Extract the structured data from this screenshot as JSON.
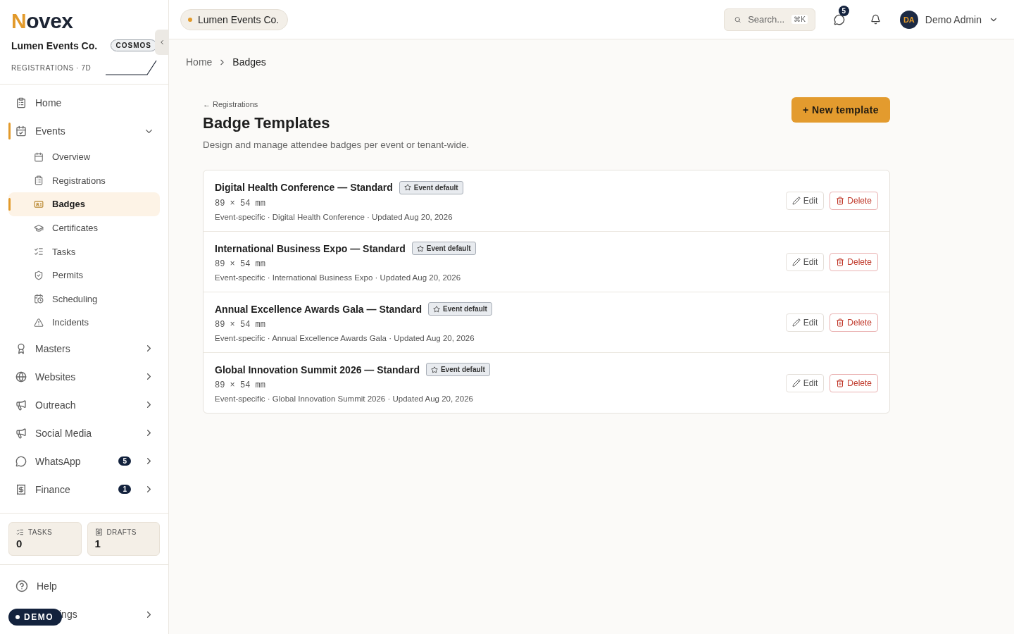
{
  "brand": {
    "logo_initial": "N",
    "logo_rest": "ovex",
    "org": "Lumen Events Co.",
    "plan": "COSMOS",
    "metric_label": "REGISTRATIONS · 7D"
  },
  "nav": [
    {
      "label": "Home",
      "selected": false
    },
    {
      "label": "Events",
      "selected": false,
      "expanded": true,
      "children": [
        {
          "label": "Overview",
          "selected": false
        },
        {
          "label": "Registrations",
          "selected": false
        },
        {
          "label": "Badges",
          "selected": true
        },
        {
          "label": "Certificates",
          "selected": false
        },
        {
          "label": "Tasks",
          "selected": false
        },
        {
          "label": "Permits",
          "selected": false
        },
        {
          "label": "Scheduling",
          "selected": false
        },
        {
          "label": "Incidents",
          "selected": false
        }
      ]
    },
    {
      "label": "Masters",
      "selected": false,
      "expanded": false
    },
    {
      "label": "Websites",
      "selected": false,
      "expanded": false
    },
    {
      "label": "Outreach",
      "selected": false,
      "expanded": false
    },
    {
      "label": "Social Media",
      "selected": false,
      "expanded": false
    },
    {
      "label": "WhatsApp",
      "selected": false,
      "expanded": false,
      "count": "5"
    },
    {
      "label": "Finance",
      "selected": false,
      "expanded": false,
      "count": "1"
    }
  ],
  "stats": [
    {
      "label": "TASKS",
      "value": "0"
    },
    {
      "label": "DRAFTS",
      "value": "1"
    }
  ],
  "footer": [
    {
      "label": "Help",
      "expandable": false
    },
    {
      "label": "ings",
      "expandable": true
    }
  ],
  "demo_badge": "DEMO",
  "topbar": {
    "tenant": "Lumen Events Co.",
    "search_placeholder": "Search...",
    "shortcut": "⌘K",
    "messages_count": "5",
    "avatar": "DA",
    "user": "Demo Admin"
  },
  "breadcrumb": [
    {
      "label": "Home",
      "selected": false
    },
    {
      "label": "Badges",
      "selected": true
    }
  ],
  "page": {
    "back_link": "← Registrations",
    "title": "Badge Templates",
    "subtitle": "Design and manage attendee badges per event or tenant-wide.",
    "primary_button": "+ New template"
  },
  "templates": [
    {
      "name": "Digital Health Conference — Standard",
      "tag": "Event default",
      "size": "89 × 54 mm",
      "meta": "Event-specific · Digital Health Conference · Updated Aug 20, 2026",
      "edit": "Edit",
      "delete": "Delete"
    },
    {
      "name": "International Business Expo — Standard",
      "tag": "Event default",
      "size": "89 × 54 mm",
      "meta": "Event-specific · International Business Expo · Updated Aug 20, 2026",
      "edit": "Edit",
      "delete": "Delete"
    },
    {
      "name": "Annual Excellence Awards Gala — Standard",
      "tag": "Event default",
      "size": "89 × 54 mm",
      "meta": "Event-specific · Annual Excellence Awards Gala · Updated Aug 20, 2026",
      "edit": "Edit",
      "delete": "Delete"
    },
    {
      "name": "Global Innovation Summit 2026 — Standard",
      "tag": "Event default",
      "size": "89 × 54 mm",
      "meta": "Event-specific · Global Innovation Summit 2026 · Updated Aug 20, 2026",
      "edit": "Edit",
      "delete": "Delete"
    }
  ]
}
